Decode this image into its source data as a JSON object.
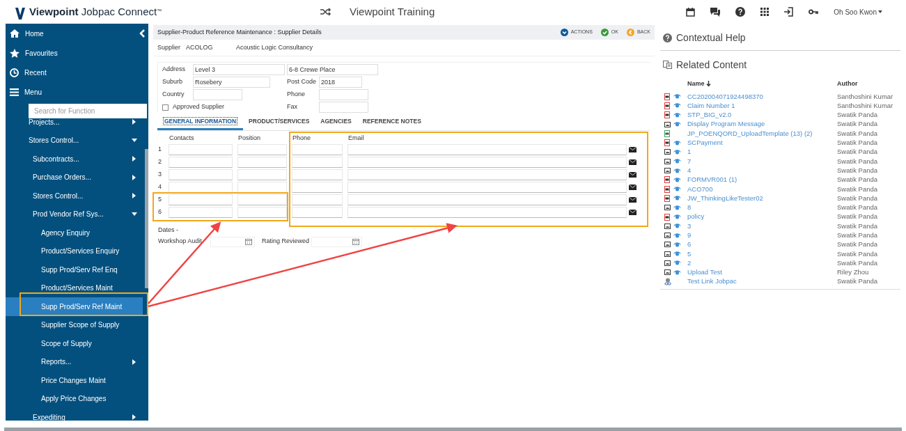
{
  "header": {
    "brand_bold": "Viewpoint",
    "brand_rest": "Jobpac Connect",
    "brand_mark": "™",
    "environment": "Viewpoint Training",
    "user": "Oh Soo Kwon"
  },
  "sidebar": {
    "nav": [
      {
        "label": "Home",
        "kind": "home"
      },
      {
        "label": "Favourites",
        "kind": "star"
      },
      {
        "label": "Recent",
        "kind": "clock"
      },
      {
        "label": "Menu",
        "kind": "menu"
      }
    ],
    "search": {
      "placeholder": "Search for Function"
    },
    "tree": [
      {
        "label": "Projects...",
        "kind": "folder",
        "expanded": false
      },
      {
        "label": "Stores Control...",
        "kind": "folder",
        "expanded": true,
        "children": [
          {
            "label": "Subcontracts...",
            "kind": "folder",
            "expanded": false
          },
          {
            "label": "Purchase Orders...",
            "kind": "folder",
            "expanded": false
          },
          {
            "label": "Stores Control...",
            "kind": "folder",
            "expanded": false
          },
          {
            "label": "Prod Vendor Ref Sys...",
            "kind": "folder",
            "expanded": true,
            "children": [
              {
                "label": "Agency Enquiry",
                "kind": "leaf",
                "selected": false
              },
              {
                "label": "Product/Services Enquiry",
                "kind": "leaf",
                "selected": false
              },
              {
                "label": "Supp Prod/Serv Ref Enq",
                "kind": "leaf",
                "selected": false
              },
              {
                "label": "Product/Services Maint",
                "kind": "leaf",
                "selected": false
              },
              {
                "label": "Supp Prod/Serv Ref Maint",
                "kind": "leaf",
                "selected": true
              },
              {
                "label": "Supplier Scope of Supply",
                "kind": "leaf",
                "selected": false
              },
              {
                "label": "Scope of Supply",
                "kind": "leaf",
                "selected": false
              },
              {
                "label": "Reports...",
                "kind": "folder",
                "expanded": false
              },
              {
                "label": "Price Changes Maint",
                "kind": "leaf",
                "selected": false
              },
              {
                "label": "Apply Price Changes",
                "kind": "leaf",
                "selected": false
              }
            ]
          },
          {
            "label": "Expediting",
            "kind": "folder",
            "expanded": false
          }
        ]
      }
    ]
  },
  "main": {
    "title": "Supplier-Product Reference Maintenance : Supplier Details",
    "actions": [
      {
        "label": "ACTIONS",
        "kind": "actions"
      },
      {
        "label": "OK",
        "kind": "ok"
      },
      {
        "label": "BACK",
        "kind": "back"
      }
    ],
    "supplier": {
      "label": "Supplier",
      "code": "ACOLOG",
      "name": "Acoustic Logic Consultancy"
    },
    "address": {
      "label": "Address",
      "line1": "Level 3",
      "line2": "6-8 Crewe Place"
    },
    "suburb": {
      "label": "Suburb",
      "value": "Rosebery"
    },
    "post_code": {
      "label": "Post Code",
      "value": "2018"
    },
    "country": {
      "label": "Country"
    },
    "phone": {
      "label": "Phone"
    },
    "fax": {
      "label": "Fax"
    },
    "approved_supplier": {
      "label": "Approved Supplier",
      "checked": false
    },
    "tabs": [
      {
        "label": "GENERAL INFORMATION",
        "selected": true
      },
      {
        "label": "PRODUCT/SERVICES",
        "selected": false
      },
      {
        "label": "AGENCIES",
        "selected": false
      },
      {
        "label": "REFERENCE NOTES",
        "selected": false
      }
    ],
    "contacts": {
      "columns": [
        "Contacts",
        "Position",
        "Phone",
        "Email"
      ],
      "rows": [
        "1",
        "2",
        "3",
        "4",
        "5",
        "6"
      ]
    },
    "dates": {
      "label": "Dates -",
      "workshop_audit": "Workshop Audit",
      "rating_reviewed": "Rating Reviewed"
    }
  },
  "help": {
    "title": "Contextual Help",
    "related_title": "Related Content",
    "columns": [
      "Name",
      "Author"
    ],
    "rows": [
      {
        "kind": "pdf",
        "viewable": true,
        "name": "CC202004071924498370",
        "author": "Santhoshini Kumar"
      },
      {
        "kind": "pdf",
        "viewable": true,
        "name": "Claim Number 1",
        "author": "Santhoshini Kumar"
      },
      {
        "kind": "pdf",
        "viewable": true,
        "name": "STP_BIG_v2.0",
        "author": "Swatik Panda"
      },
      {
        "kind": "image",
        "viewable": true,
        "name": "Display Program Message",
        "author": "Swatik Panda"
      },
      {
        "kind": "xls",
        "viewable": false,
        "name": "JP_POENQORD_UploadTemplate (13) (2)",
        "author": "Swatik Panda"
      },
      {
        "kind": "pdf",
        "viewable": true,
        "name": "SCPayment",
        "author": "Swatik Panda"
      },
      {
        "kind": "image",
        "viewable": true,
        "name": "1",
        "author": "Swatik Panda"
      },
      {
        "kind": "image",
        "viewable": true,
        "name": "7",
        "author": "Swatik Panda"
      },
      {
        "kind": "image",
        "viewable": true,
        "name": "4",
        "author": "Swatik Panda"
      },
      {
        "kind": "pdf",
        "viewable": true,
        "name": "FORMVR001 (1)",
        "author": "Swatik Panda"
      },
      {
        "kind": "pdf",
        "viewable": true,
        "name": "ACO700",
        "author": "Swatik Panda"
      },
      {
        "kind": "pdf",
        "viewable": true,
        "name": "JW_ThinkingLikeTester02",
        "author": "Swatik Panda"
      },
      {
        "kind": "image",
        "viewable": true,
        "name": "8",
        "author": "Swatik Panda"
      },
      {
        "kind": "pdf",
        "viewable": true,
        "name": "policy",
        "author": "Swatik Panda"
      },
      {
        "kind": "image",
        "viewable": true,
        "name": "3",
        "author": "Swatik Panda"
      },
      {
        "kind": "image",
        "viewable": true,
        "name": "9",
        "author": "Swatik Panda"
      },
      {
        "kind": "image",
        "viewable": true,
        "name": "6",
        "author": "Swatik Panda"
      },
      {
        "kind": "image",
        "viewable": true,
        "name": "5",
        "author": "Swatik Panda"
      },
      {
        "kind": "image",
        "viewable": true,
        "name": "2",
        "author": "Swatik Panda"
      },
      {
        "kind": "image",
        "viewable": true,
        "name": "Upload Test",
        "author": "Riley Zhou"
      },
      {
        "kind": "link",
        "viewable": false,
        "name": "Test Link Jobpac",
        "author": "Swatik Panda"
      }
    ]
  }
}
